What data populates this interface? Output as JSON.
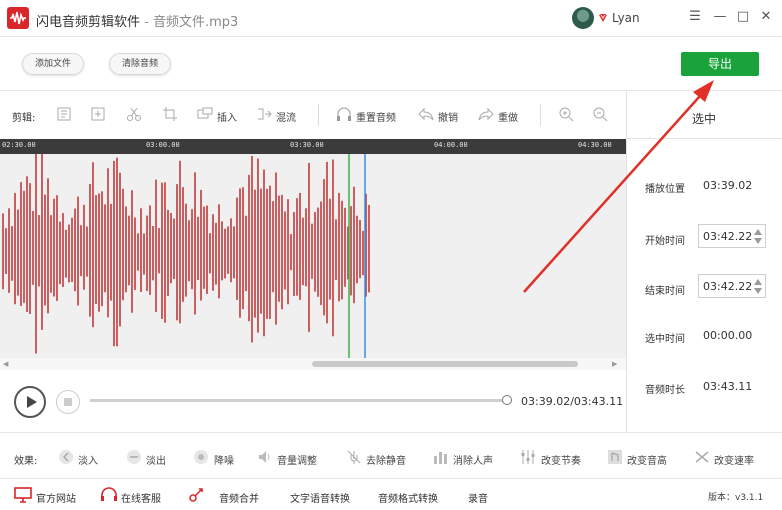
{
  "window": {
    "app_name": "闪电音频剪辑软件",
    "separator": "-",
    "file_name": "音频文件.mp3",
    "username": "Lyan",
    "controls": {
      "menu": "☰",
      "minimize": "—",
      "maximize": "□",
      "close": "✕"
    }
  },
  "actions": {
    "add_file": "添加文件",
    "clear_audio": "清除音频",
    "export": "导出"
  },
  "toolbar": {
    "label": "剪辑:",
    "insert": "插入",
    "mix": "混流",
    "reset_audio": "重置音频",
    "undo": "撤销",
    "redo": "重做"
  },
  "timeline": {
    "ticks": [
      "02:30.00",
      "03:00.00",
      "03:30.00",
      "04:00.00",
      "04:30.00"
    ]
  },
  "selection_panel": {
    "title": "选中",
    "play_position_label": "播放位置",
    "play_position": "03:39.02",
    "start_label": "开始时间",
    "start_time": "03:42.22",
    "end_label": "结束时间",
    "end_time": "03:42.22",
    "selected_label": "选中时间",
    "selected_time": "00:00.00",
    "duration_label": "音频时长",
    "duration": "03:43.11"
  },
  "playback": {
    "time_readout": "03:39.02/03:43.11",
    "progress_fraction": 0.983
  },
  "effects": {
    "label": "效果:",
    "items": [
      "淡入",
      "淡出",
      "降噪",
      "音量调整",
      "去除静音",
      "消除人声",
      "改变节奏",
      "改变音高",
      "改变速率"
    ]
  },
  "footer": {
    "items": [
      "官方网站",
      "在线客服",
      "音频合并",
      "文字语音转换",
      "音频格式转换",
      "录音"
    ],
    "version": "版本：v3.1.1"
  },
  "colors": {
    "brand_red": "#d9262b",
    "export_green": "#1aa33a",
    "waveform": "#c0393b",
    "play_cursor": "#3a8ee6",
    "selection_marker": "#3cb043",
    "annotation_arrow": "#e0302a"
  }
}
